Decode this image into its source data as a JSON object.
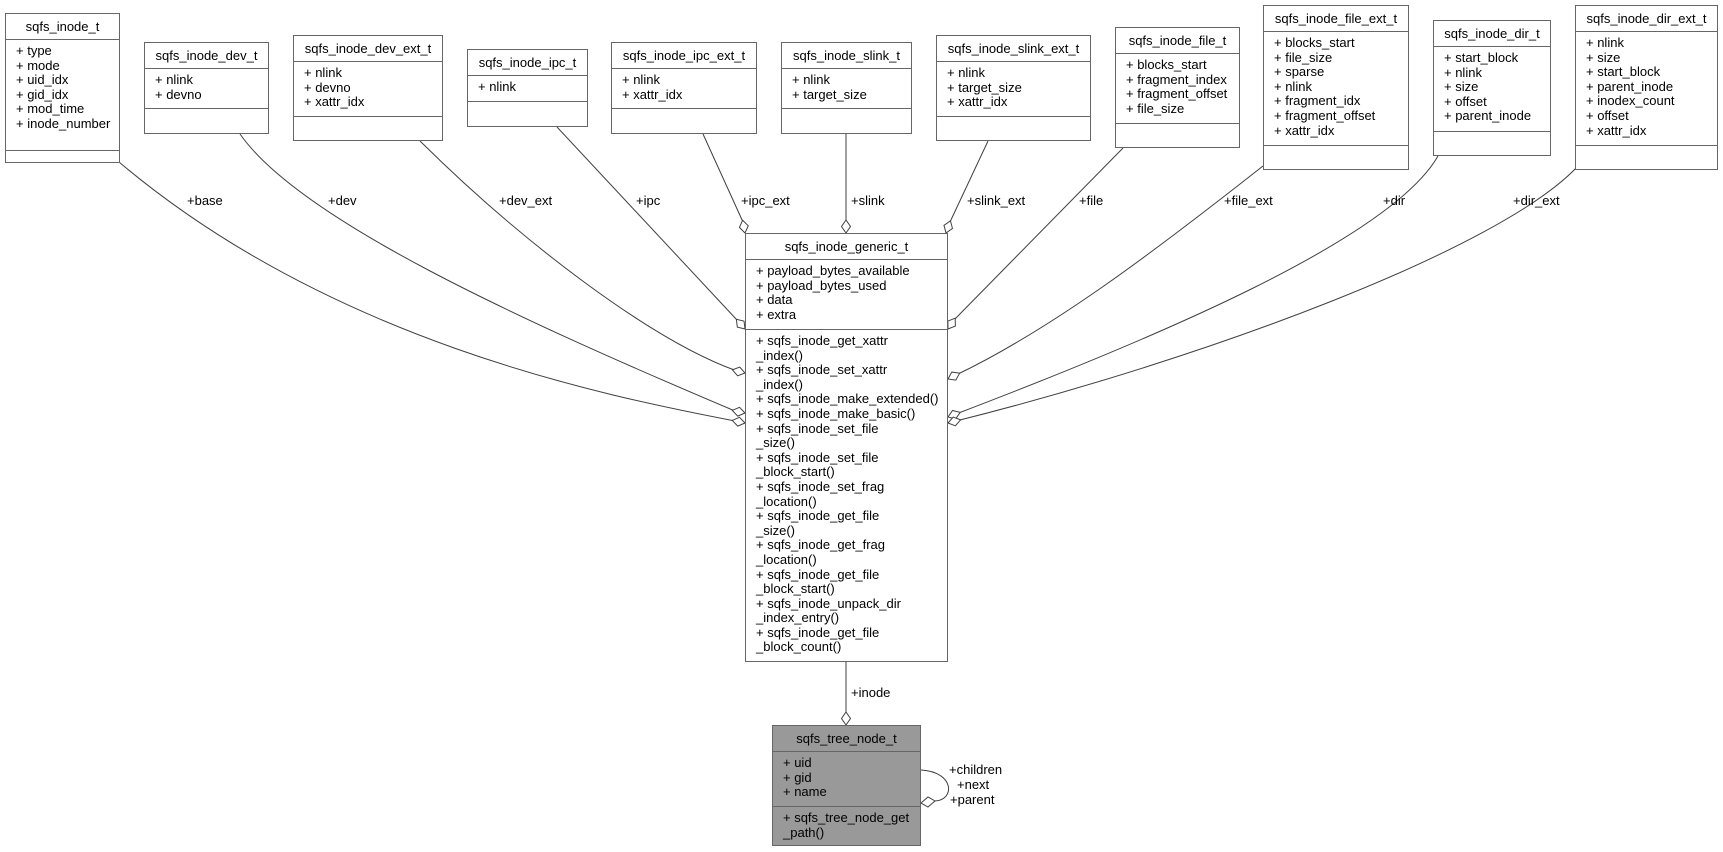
{
  "diagram": {
    "type": "collaboration",
    "boxes": [
      {
        "id": "sqfs_inode_t",
        "title": "sqfs_inode_t",
        "attributes": [
          "+ type",
          "+ mode",
          "+ uid_idx",
          "+ gid_idx",
          "+ mod_time",
          "+ inode_number"
        ],
        "methods": []
      },
      {
        "id": "sqfs_inode_dev_t",
        "title": "sqfs_inode_dev_t",
        "attributes": [
          "+ nlink",
          "+ devno"
        ],
        "methods": []
      },
      {
        "id": "sqfs_inode_dev_ext_t",
        "title": "sqfs_inode_dev_ext_t",
        "attributes": [
          "+ nlink",
          "+ devno",
          "+ xattr_idx"
        ],
        "methods": []
      },
      {
        "id": "sqfs_inode_ipc_t",
        "title": "sqfs_inode_ipc_t",
        "attributes": [
          "+ nlink"
        ],
        "methods": []
      },
      {
        "id": "sqfs_inode_ipc_ext_t",
        "title": "sqfs_inode_ipc_ext_t",
        "attributes": [
          "+ nlink",
          "+ xattr_idx"
        ],
        "methods": []
      },
      {
        "id": "sqfs_inode_slink_t",
        "title": "sqfs_inode_slink_t",
        "attributes": [
          "+ nlink",
          "+ target_size"
        ],
        "methods": []
      },
      {
        "id": "sqfs_inode_slink_ext_t",
        "title": "sqfs_inode_slink_ext_t",
        "attributes": [
          "+ nlink",
          "+ target_size",
          "+ xattr_idx"
        ],
        "methods": []
      },
      {
        "id": "sqfs_inode_file_t",
        "title": "sqfs_inode_file_t",
        "attributes": [
          "+ blocks_start",
          "+ fragment_index",
          "+ fragment_offset",
          "+ file_size"
        ],
        "methods": []
      },
      {
        "id": "sqfs_inode_file_ext_t",
        "title": "sqfs_inode_file_ext_t",
        "attributes": [
          "+ blocks_start",
          "+ file_size",
          "+ sparse",
          "+ nlink",
          "+ fragment_idx",
          "+ fragment_offset",
          "+ xattr_idx"
        ],
        "methods": []
      },
      {
        "id": "sqfs_inode_dir_t",
        "title": "sqfs_inode_dir_t",
        "attributes": [
          "+ start_block",
          "+ nlink",
          "+ size",
          "+ offset",
          "+ parent_inode"
        ],
        "methods": []
      },
      {
        "id": "sqfs_inode_dir_ext_t",
        "title": "sqfs_inode_dir_ext_t",
        "attributes": [
          "+ nlink",
          "+ size",
          "+ start_block",
          "+ parent_inode",
          "+ inodex_count",
          "+ offset",
          "+ xattr_idx"
        ],
        "methods": []
      },
      {
        "id": "sqfs_inode_generic_t",
        "title": "sqfs_inode_generic_t",
        "attributes": [
          "+ payload_bytes_available",
          "+ payload_bytes_used",
          "+ data",
          "+ extra"
        ],
        "methods": [
          "+ sqfs_inode_get_xattr",
          "_index()",
          "+ sqfs_inode_set_xattr",
          "_index()",
          "+ sqfs_inode_make_extended()",
          "+ sqfs_inode_make_basic()",
          "+ sqfs_inode_set_file",
          "_size()",
          "+ sqfs_inode_set_file",
          "_block_start()",
          "+ sqfs_inode_set_frag",
          "_location()",
          "+ sqfs_inode_get_file",
          "_size()",
          "+ sqfs_inode_get_frag",
          "_location()",
          "+ sqfs_inode_get_file",
          "_block_start()",
          "+ sqfs_inode_unpack_dir",
          "_index_entry()",
          "+ sqfs_inode_get_file",
          "_block_count()"
        ]
      },
      {
        "id": "sqfs_tree_node_t",
        "title": "sqfs_tree_node_t",
        "attributes": [
          "+ uid",
          "+ gid",
          "+ name"
        ],
        "methods": [
          "+ sqfs_tree_node_get",
          "_path()"
        ]
      }
    ],
    "edges": [
      {
        "from": "sqfs_inode_t",
        "to": "sqfs_inode_generic_t",
        "label": "+base"
      },
      {
        "from": "sqfs_inode_dev_t",
        "to": "sqfs_inode_generic_t",
        "label": "+dev"
      },
      {
        "from": "sqfs_inode_dev_ext_t",
        "to": "sqfs_inode_generic_t",
        "label": "+dev_ext"
      },
      {
        "from": "sqfs_inode_ipc_t",
        "to": "sqfs_inode_generic_t",
        "label": "+ipc"
      },
      {
        "from": "sqfs_inode_ipc_ext_t",
        "to": "sqfs_inode_generic_t",
        "label": "+ipc_ext"
      },
      {
        "from": "sqfs_inode_slink_t",
        "to": "sqfs_inode_generic_t",
        "label": "+slink"
      },
      {
        "from": "sqfs_inode_slink_ext_t",
        "to": "sqfs_inode_generic_t",
        "label": "+slink_ext"
      },
      {
        "from": "sqfs_inode_file_t",
        "to": "sqfs_inode_generic_t",
        "label": "+file"
      },
      {
        "from": "sqfs_inode_file_ext_t",
        "to": "sqfs_inode_generic_t",
        "label": "+file_ext"
      },
      {
        "from": "sqfs_inode_dir_t",
        "to": "sqfs_inode_generic_t",
        "label": "+dir"
      },
      {
        "from": "sqfs_inode_dir_ext_t",
        "to": "sqfs_inode_generic_t",
        "label": "+dir_ext"
      },
      {
        "from": "sqfs_inode_generic_t",
        "to": "sqfs_tree_node_t",
        "label": "+inode"
      },
      {
        "from": "sqfs_tree_node_t",
        "to": "sqfs_tree_node_t",
        "label": "+children\n+next\n+parent",
        "label_lines": [
          "+children",
          "+next",
          "+parent"
        ]
      }
    ],
    "colors": {
      "border": "#666666",
      "highlight_fill": "#999999",
      "edge": "#404040"
    }
  }
}
